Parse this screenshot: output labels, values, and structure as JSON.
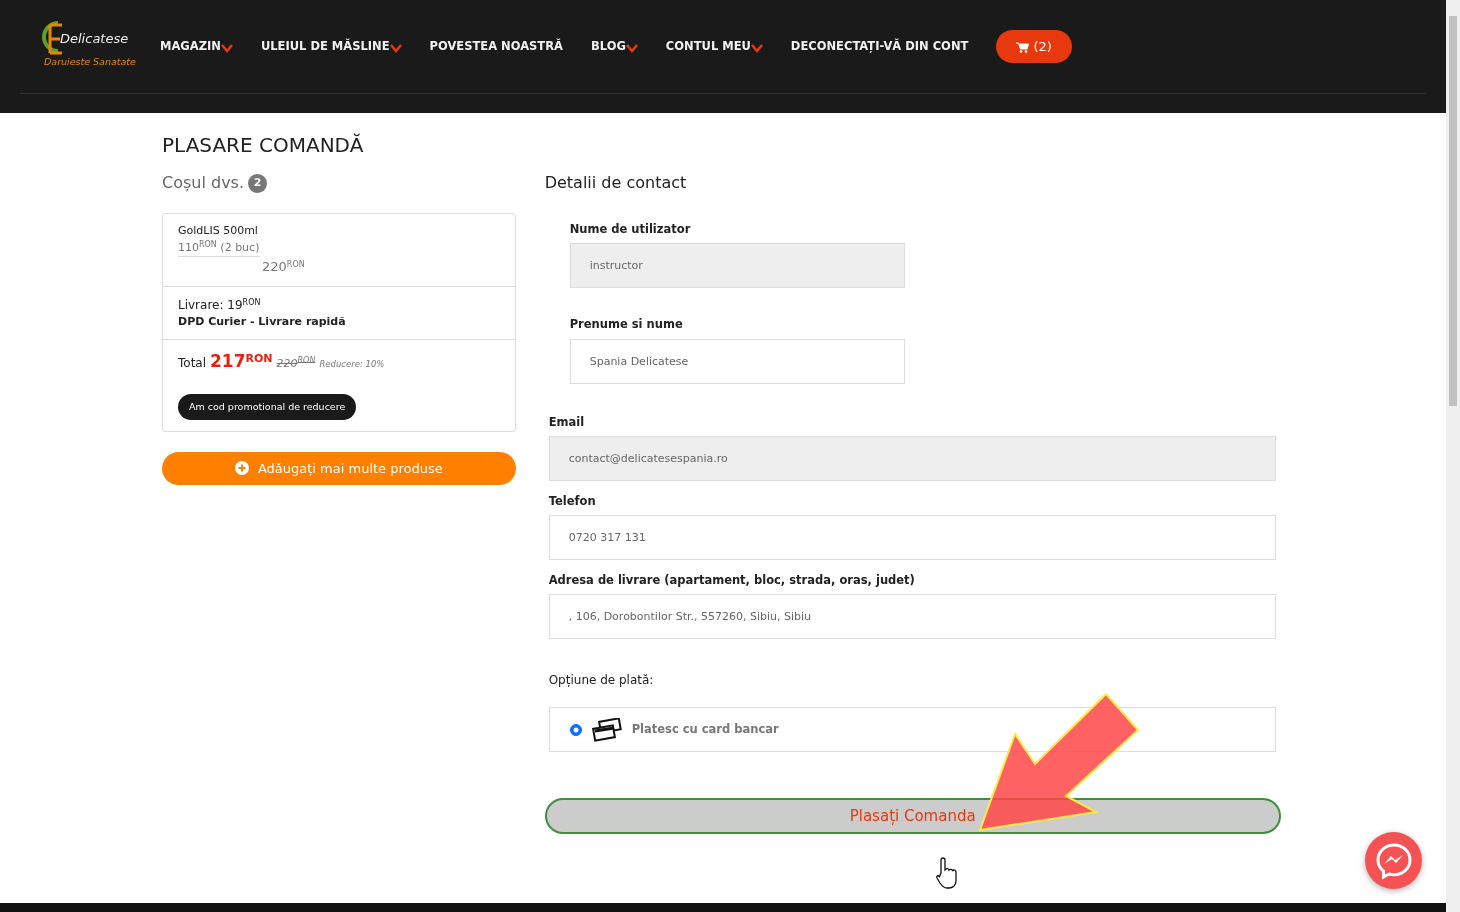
{
  "logo": {
    "name": "Delicatese",
    "tagline": "Daruieste Sanatate"
  },
  "nav": [
    {
      "label": "MAGAZIN",
      "dropdown": true
    },
    {
      "label": "ULEIUL DE MĂSLINE",
      "dropdown": true
    },
    {
      "label": "POVESTEA NOASTRĂ",
      "dropdown": false
    },
    {
      "label": "BLOG",
      "dropdown": true
    },
    {
      "label": "CONTUL MEU",
      "dropdown": true
    },
    {
      "label": "DECONECTAȚI-VĂ DIN CONT",
      "dropdown": false
    }
  ],
  "cart_button": "(2)",
  "page_title": "PLASARE COMANDĂ",
  "cart": {
    "title": "Coșul dvs.",
    "count": "2",
    "product": {
      "name": "GoldLIS 500ml",
      "unit_price": "110",
      "currency": "RON",
      "quantity": "(2 buc)",
      "line_total": "220",
      "line_currency": "RON"
    },
    "delivery": {
      "label": "Livrare: 19",
      "currency": "RON",
      "method": "DPD Curier - Livrare rapidă"
    },
    "total": {
      "label": "Total",
      "amount": "217",
      "currency": "RON",
      "old_amount": "220",
      "old_currency": "RON",
      "discount": "Reducere: 10%"
    },
    "promo_button": "Am cod promotional de reducere",
    "add_button": "Adăugați mai multe produse"
  },
  "contact": {
    "title": "Detalii de contact",
    "fields": [
      {
        "label": "Nume de utilizator",
        "value": "instructor",
        "readonly": true,
        "kind": "short"
      },
      {
        "label": "Prenume si nume",
        "value": "Spania Delicatese",
        "readonly": false,
        "kind": "short"
      },
      {
        "label": "Email",
        "value": "contact@delicatesespania.ro",
        "readonly": true,
        "kind": "wide"
      },
      {
        "label": "Telefon",
        "value": "0720 317 131",
        "readonly": false,
        "kind": "wide"
      },
      {
        "label": "Adresa de livrare (apartament, bloc, strada, oras, judet)",
        "value": ", 106, Dorobontilor Str., 557260, Sibiu, Sibiu",
        "readonly": false,
        "kind": "wide"
      }
    ],
    "payment_label": "Opțiune de plată:",
    "payment_options": [
      {
        "label": "Platesc cu card bancar",
        "selected": true
      }
    ],
    "submit_button": "Plasați Comanda"
  }
}
